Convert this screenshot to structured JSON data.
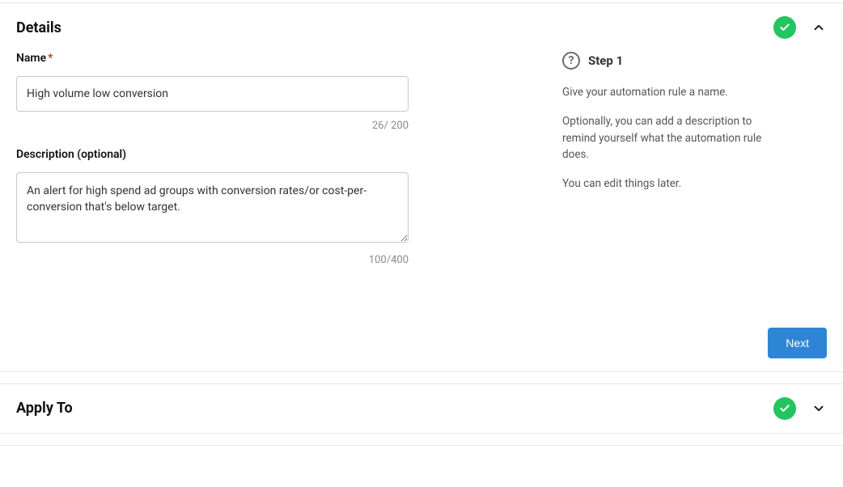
{
  "details": {
    "title": "Details",
    "name_label": "Name",
    "name_value": "High volume low conversion",
    "name_count": "26/ 200",
    "description_label": "Description (optional)",
    "description_value": "An alert for high spend ad groups with conversion rates/or cost-per-conversion that's below target.",
    "description_count": "100/400",
    "next_button": "Next"
  },
  "help": {
    "step_label": "Step 1",
    "line1": "Give your automation rule a name.",
    "line2": "Optionally, you can add a description to remind yourself what the automation rule does.",
    "line3": "You can edit things later."
  },
  "apply_to": {
    "title": "Apply To"
  }
}
